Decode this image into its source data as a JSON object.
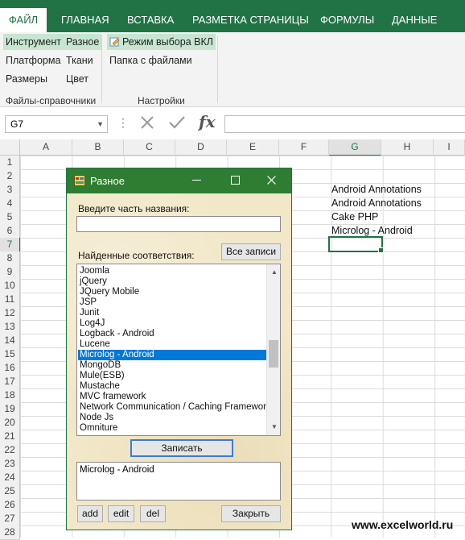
{
  "ribbon_tabs": {
    "file": "ФАЙЛ",
    "home": "ГЛАВНАЯ",
    "insert": "ВСТАВКА",
    "page_layout": "РАЗМЕТКА СТРАНИЦЫ",
    "formulas": "ФОРМУЛЫ",
    "data": "ДАННЫЕ"
  },
  "ribbon": {
    "instrument": "Инструмент",
    "raznoe": "Разное",
    "platforma": "Платформа",
    "tkani": "Ткани",
    "razmery": "Размеры",
    "tsvet": "Цвет",
    "rezhim": "Режим выбора ВКЛ",
    "papka": "Папка с файлами",
    "group_files": "Файлы-справочники",
    "group_settings": "Настройки"
  },
  "formula_bar": {
    "name_box": "G7",
    "value": ""
  },
  "sheet": {
    "columns": [
      "A",
      "B",
      "C",
      "D",
      "E",
      "F",
      "G",
      "H",
      "I"
    ],
    "rows": [
      "1",
      "2",
      "3",
      "4",
      "5",
      "6",
      "7",
      "8",
      "9",
      "10",
      "11",
      "12",
      "13",
      "14",
      "15",
      "16",
      "17",
      "18",
      "19",
      "20",
      "21",
      "22",
      "23",
      "24",
      "25",
      "26",
      "27",
      "28"
    ],
    "cells": {
      "G3": "Android Annotations",
      "G4": "Android Annotations",
      "G5": "Cake PHP",
      "G6": "Microlog - Android"
    },
    "selected_cell": "G7"
  },
  "dialog": {
    "title": "Разное",
    "search_label": "Введите часть названия:",
    "search_value": "",
    "found_label": "Найденные соответствия:",
    "all_records_button": "Все записи",
    "list_items": [
      "Joomla",
      "jQuery",
      "JQuery Mobile",
      "JSP",
      "Junit",
      "Log4J",
      "Logback - Android",
      "Lucene",
      "Microlog - Android",
      "MongoDB",
      "Mule(ESB)",
      "Mustache",
      "MVC framework",
      "Network Communication / Caching Framework",
      "Node Js",
      "Omniture"
    ],
    "selected_item": "Microlog - Android",
    "write_button": "Записать",
    "memo_text": "Microlog - Android",
    "add_button": "add",
    "edit_button": "edit",
    "del_button": "del",
    "close_button": "Закрыть"
  },
  "watermark": "www.excelworld.ru",
  "colors": {
    "excel_green": "#217346",
    "dialog_title_green": "#2e7d32",
    "selection_blue": "#0078d7",
    "dialog_background": "#f2e8c9"
  }
}
